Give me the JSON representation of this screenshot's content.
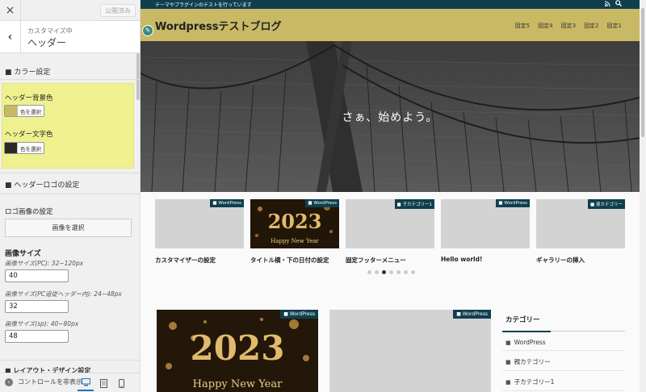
{
  "sidebar": {
    "close_icon": "×",
    "published_label": "公開済み",
    "back_icon": "‹",
    "customizing_label": "カスタマイズ中",
    "section_title": "ヘッダー",
    "color_group_title": "■ カラー設定",
    "header_bg_label": "ヘッダー背景色",
    "header_bg_color": "#c9b965",
    "header_text_label": "ヘッダー文字色",
    "header_text_color": "#2a2a22",
    "select_color_label": "色を選択",
    "logo_group_title": "■ ヘッダーロゴの設定",
    "logo_image_label": "ロゴ画像の設定",
    "select_image_label": "画像を選択",
    "image_size_heading": "画像サイズ",
    "size_pc_label": "画像サイズ(PC): 32~120px",
    "size_pc_value": "40",
    "size_pc_follow_label": "画像サイズ(PC追従ヘッダー内): 24~48px",
    "size_pc_follow_value": "32",
    "size_sp_label": "画像サイズ(sp): 40~80px",
    "size_sp_value": "48",
    "layout_group_title": "■ レイアウト・デザイン設定",
    "hide_controls_label": "コントロールを非表示",
    "device_icons": [
      "desktop-icon",
      "tablet-icon",
      "mobile-icon"
    ]
  },
  "preview": {
    "top_bar_text": "テーマやプラグインのテストを行っています",
    "site_title": "Wordpressテストブログ",
    "nav_items": [
      "固定5",
      "固定4",
      "固定3",
      "固定2",
      "固定1"
    ],
    "hero_text": "さぁ、始めよう。",
    "cards": [
      {
        "badge": "WordPress",
        "title": "カスタマイザーの設定",
        "image": "blank"
      },
      {
        "badge": "WordPress",
        "title": "タイトル横・下の日付の設定",
        "image": "new-year"
      },
      {
        "badge": "子カテゴリー1",
        "title": "固定フッターメニュー",
        "image": "blank"
      },
      {
        "badge": "WordPress",
        "title": "Hello world!",
        "image": "blank"
      },
      {
        "badge": "孫カテゴリー",
        "title": "ギャラリーの挿入",
        "image": "blank"
      }
    ],
    "slider_dots": 7,
    "slider_active_index": 2,
    "new_year_year": "2023",
    "new_year_text": "Happy New Year",
    "post_badges": [
      "WordPress",
      "WordPress"
    ],
    "widget": {
      "title": "カテゴリー",
      "items": [
        "WordPress",
        "親カテゴリー",
        "子カテゴリー1"
      ]
    },
    "colors": {
      "top_bar": "#0f3f4f",
      "header_bg": "#c9b965",
      "accent": "#0f3f4f"
    }
  }
}
